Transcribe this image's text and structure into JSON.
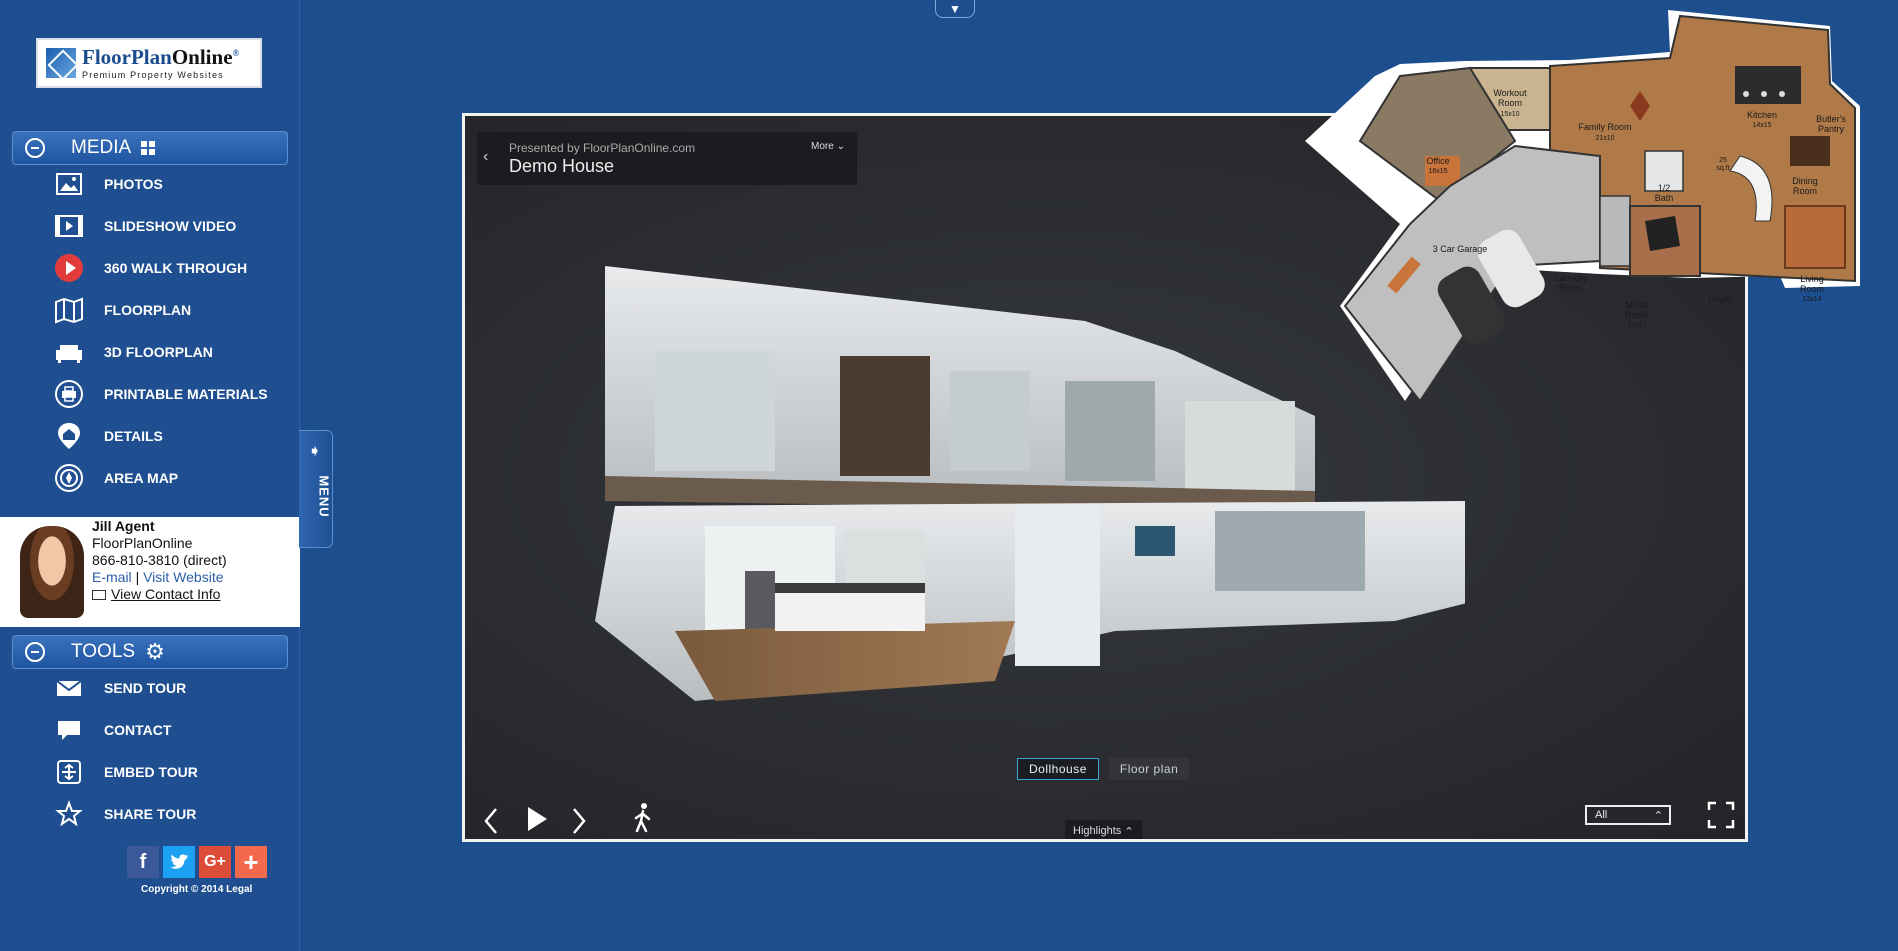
{
  "logo": {
    "brand_a": "FloorPlan",
    "brand_b": "Online",
    "reg": "®",
    "tagline": "Premium Property Websites"
  },
  "media": {
    "title": "MEDIA",
    "items": [
      {
        "label": "PHOTOS",
        "icon": "photo-icon"
      },
      {
        "label": "SLIDESHOW VIDEO",
        "icon": "video-icon"
      },
      {
        "label": "360 WALK THROUGH",
        "icon": "play-circle-icon"
      },
      {
        "label": "FLOORPLAN",
        "icon": "map-icon"
      },
      {
        "label": "3D FLOORPLAN",
        "icon": "sofa-icon"
      },
      {
        "label": "PRINTABLE MATERIALS",
        "icon": "printer-icon"
      },
      {
        "label": "DETAILS",
        "icon": "house-pin-icon"
      },
      {
        "label": "AREA MAP",
        "icon": "compass-icon"
      }
    ]
  },
  "agent": {
    "name": "Jill Agent",
    "company": "FloorPlanOnline",
    "phone": "866-810-3810 (direct)",
    "email": "E-mail",
    "separator": "|",
    "website": "Visit Website",
    "contact": "View Contact Info"
  },
  "tools": {
    "title": "TOOLS",
    "items": [
      {
        "label": "SEND TOUR",
        "icon": "envelope-icon"
      },
      {
        "label": "CONTACT",
        "icon": "chat-bubble-icon"
      },
      {
        "label": "EMBED TOUR",
        "icon": "embed-icon"
      },
      {
        "label": "SHARE TOUR",
        "icon": "star-icon"
      }
    ]
  },
  "social": {
    "facebook": "f",
    "google": "G+",
    "more": "+"
  },
  "copyright": "Copyright © 2014 Legal",
  "menu_tab": "MENU",
  "viewer": {
    "presented_by": "Presented by FloorPlanOnline.com",
    "house_name": "Demo House",
    "more": "More",
    "view_dollhouse": "Dollhouse",
    "view_floorplan": "Floor plan",
    "highlights": "Highlights",
    "filter": "All"
  },
  "floorplan": {
    "rooms": {
      "workout": "Workout",
      "workout_b": "Room",
      "workout_size": "15x10",
      "office": "Office",
      "office_size": "16x15",
      "family": "Family Room",
      "family_size": "21x10",
      "kitchen": "Kitchen",
      "kitchen_size": "14x15",
      "pantry": "Butler's",
      "pantry_b": "Pantry",
      "half_bath": "1/2",
      "half_bath_b": "Bath",
      "sqft": "25",
      "sqft_b": "sq.ft",
      "dining": "Dining",
      "dining_b": "Room",
      "garage": "3 Car Garage",
      "laundry": "Laundry",
      "laundry_b": "Room",
      "music": "Music",
      "music_b": "Room",
      "music_size": "11x12",
      "foyer": "Foyer",
      "living": "Living",
      "living_b": "Room",
      "living_size": "13x14"
    }
  },
  "colors": {
    "sidebar": "#1f4f90",
    "accent": "#3aa5d8",
    "viewer_bg": "#2a2c30",
    "facebook": "#3b5998",
    "twitter": "#1da1f2",
    "google": "#dd4b39",
    "more": "#f26a4b"
  }
}
